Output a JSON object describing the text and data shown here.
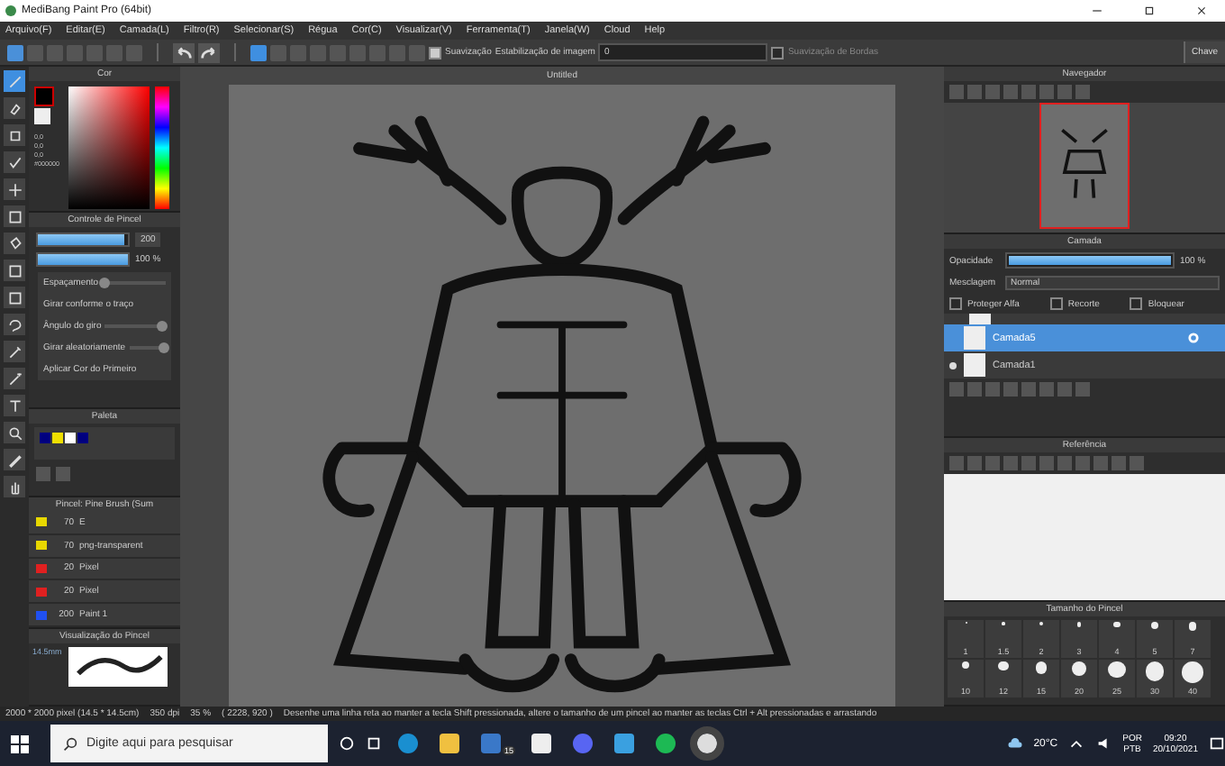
{
  "window": {
    "title": "MediBang Paint Pro (64bit)"
  },
  "menu": [
    "Arquivo(F)",
    "Editar(E)",
    "Camada(L)",
    "Filtro(R)",
    "Selecionar(S)",
    "Régua",
    "Cor(C)",
    "Visualizar(V)",
    "Ferramenta(T)",
    "Janela(W)",
    "Cloud",
    "Help"
  ],
  "toolbar": {
    "snaps": [
      {
        "selected": true
      },
      {
        "selected": false
      },
      {
        "selected": false
      },
      {
        "selected": false
      },
      {
        "selected": false
      },
      {
        "selected": false
      },
      {
        "selected": false
      },
      {
        "selected": false
      },
      {
        "selected": false
      }
    ],
    "smoothing": {
      "label": "Suavização",
      "checked": true
    },
    "stabilization": {
      "label": "Estabilização de imagem",
      "value": "0"
    },
    "edge_smoothing": {
      "label": "Suavização de Bordas",
      "checked": false
    },
    "key_button": "Chave"
  },
  "tools": [
    {
      "selected": true
    },
    {
      "selected": false
    },
    {
      "selected": false
    },
    {
      "selected": false
    },
    {
      "selected": false
    },
    {
      "selected": false
    },
    {
      "selected": false
    },
    {
      "selected": false
    },
    {
      "selected": false
    },
    {
      "selected": false
    },
    {
      "selected": false
    },
    {
      "selected": false
    },
    {
      "selected": false
    },
    {
      "selected": false
    },
    {
      "selected": false
    },
    {
      "selected": false
    }
  ],
  "color_panel": {
    "title": "Cor",
    "values": [
      "0,0",
      "0,0",
      "0,0",
      "#000000"
    ]
  },
  "brush_control": {
    "title": "Controle de Pincel",
    "size": {
      "level": 0.95,
      "value": "200"
    },
    "opacity": {
      "level": 1,
      "value": "100 %"
    },
    "options": [
      {
        "label": "Espaçamento",
        "level": 0.05
      },
      {
        "label": "Girar conforme o traço"
      },
      {
        "label": "Ângulo do giro",
        "level": 0.95
      },
      {
        "label": "Girar aleatoriamente",
        "level": 0.95
      },
      {
        "label": "Aplicar Cor do Primeiro"
      }
    ]
  },
  "palette": {
    "title": "Paleta",
    "colors": [
      {
        "color": "#000080"
      },
      {
        "color": "#f0e000"
      },
      {
        "color": "#ffffff"
      },
      {
        "color": "#000080"
      }
    ]
  },
  "brushes": {
    "title": "Pincel: Pine Brush (Sum",
    "items": [
      {
        "size": "70",
        "name": "E",
        "color": "#e8d800"
      },
      {
        "size": "70",
        "name": "png-transparent",
        "color": "#e8d800"
      },
      {
        "size": "20",
        "name": "Pixel",
        "color": "#e02020"
      },
      {
        "size": "20",
        "name": "Pixel",
        "color": "#e02020"
      },
      {
        "size": "200",
        "name": "Paint 1",
        "color": "#2050f0"
      }
    ]
  },
  "brush_preview": {
    "title": "Visualização do Pincel",
    "size": "14.5mm"
  },
  "canvas": {
    "tab": "Untitled"
  },
  "navigator": {
    "title": "Navegador"
  },
  "layers": {
    "title": "Camada",
    "opacity": {
      "label": "Opacidade",
      "level": 1,
      "value": "100 %"
    },
    "blend": {
      "label": "Mesclagem",
      "value": "Normal"
    },
    "checks": [
      {
        "label": "Proteger Alfa",
        "checked": false
      },
      {
        "label": "Recorte",
        "checked": false
      },
      {
        "label": "Bloquear",
        "checked": false
      }
    ],
    "items": [
      {
        "name": "Camada5",
        "selected": true,
        "visible": false
      },
      {
        "name": "Camada1",
        "selected": false,
        "visible": true
      }
    ]
  },
  "reference": {
    "title": "Referência"
  },
  "brush_size": {
    "title": "Tamanho do Pincel",
    "sizes": [
      "1",
      "1.5",
      "2",
      "3",
      "4",
      "5",
      "7",
      "10",
      "12",
      "15",
      "20",
      "25",
      "30",
      "40"
    ]
  },
  "status_bar": [
    "2000 * 2000 pixel  (14.5 * 14.5cm)",
    "350 dpi",
    "35 %",
    "( 2228, 920 )",
    "Desenhe uma linha reta ao manter a tecla Shift pressionada, altere o tamanho de um pincel ao manter as teclas Ctrl + Alt pressionadas e arrastando"
  ],
  "taskbar": {
    "search_placeholder": "Digite aqui para pesquisar",
    "mail_badge": "15",
    "weather": "20°C",
    "language": [
      "POR",
      "PTB"
    ],
    "time": "09:20",
    "date": "20/10/2021"
  }
}
